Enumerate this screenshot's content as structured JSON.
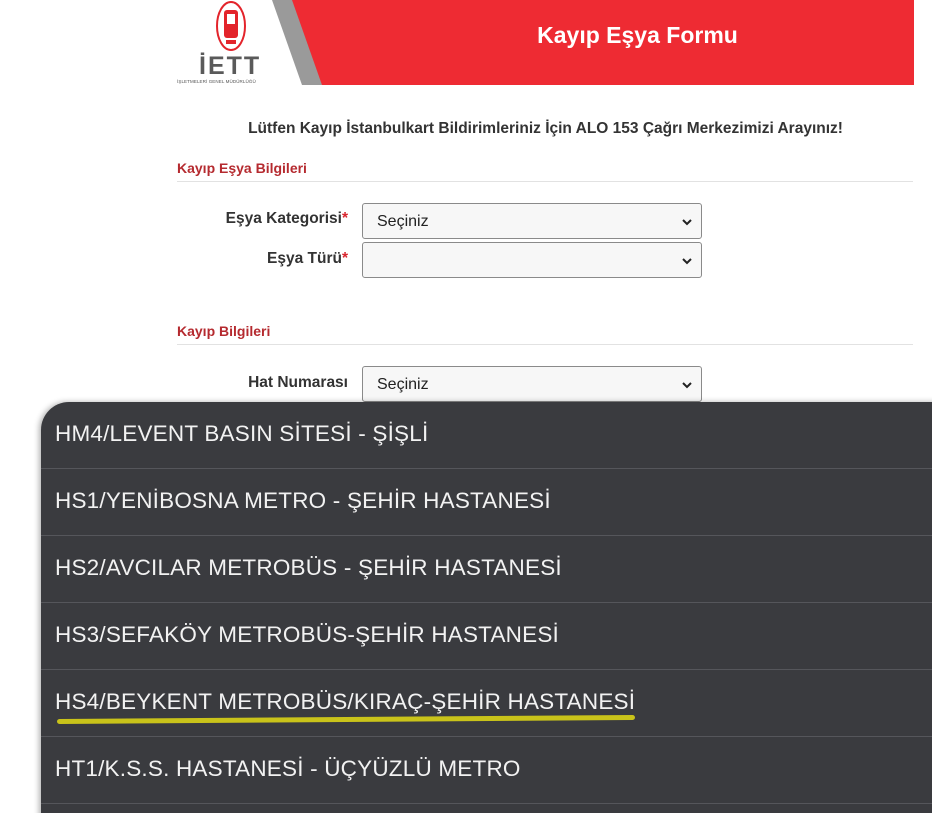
{
  "header": {
    "logo_text": "İETT",
    "logo_subtitle": "İŞLETMELERİ GENEL MÜDÜRLÜĞÜ",
    "title": "Kayıp Eşya Formu",
    "brand_color": "#ee2b33"
  },
  "notice": "Lütfen Kayıp İstanbulkart Bildirimleriniz İçin ALO 153 Çağrı Merkezimizi Arayınız!",
  "sections": {
    "item_info": {
      "title": "Kayıp Eşya Bilgileri",
      "category_label": "Eşya Kategorisi",
      "category_value": "Seçiniz",
      "type_label": "Eşya Türü",
      "type_value": "",
      "required_mark": "*"
    },
    "loss_info": {
      "title": "Kayıp Bilgileri",
      "line_label": "Hat Numarası",
      "line_value": "Seçiniz"
    }
  },
  "dropdown": {
    "options": [
      "HM4/LEVENT BASIN SİTESİ - ŞİŞLİ",
      "HS1/YENİBOSNA METRO - ŞEHİR HASTANESİ",
      "HS2/AVCILAR METROBÜS - ŞEHİR HASTANESİ",
      "HS3/SEFAKÖY METROBÜS-ŞEHİR HASTANESİ",
      "HS4/BEYKENT METROBÜS/KIRAÇ-ŞEHİR HASTANESİ",
      "HT1/K.S.S. HASTANESİ - ÜÇYÜZLÜ METRO"
    ],
    "highlighted_option": "HS4/BEYKENT METROBÜS/KIRAÇ-ŞEHİR HASTANESİ",
    "highlight_color": "#c9c31a"
  },
  "icons": {
    "select_chevron": "chevron-down-icon",
    "logo_emblem": "iett-emblem-icon"
  }
}
